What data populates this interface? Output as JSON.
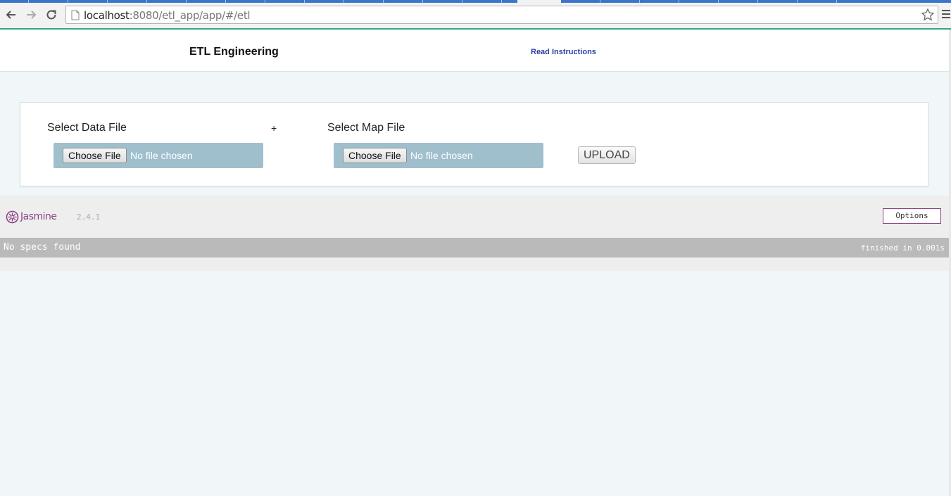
{
  "browser": {
    "url_host": "localhost",
    "url_rest": ":8080/etl_app/app/#/etl"
  },
  "header": {
    "title": "ETL Engineering",
    "read_link": "Read Instructions"
  },
  "upload": {
    "data_label": "Select Data File",
    "plus": "+",
    "map_label": "Select Map File",
    "choose_label": "Choose File",
    "no_file": "No file chosen",
    "upload_label": "UPLOAD"
  },
  "jasmine": {
    "name": "Jasmine",
    "version": "2.4.1",
    "options_label": "Options",
    "status": "No specs found",
    "duration": "finished in 0.001s"
  },
  "colors": {
    "accent_line": "#2fa87e",
    "file_box": "#9fbfcd",
    "jasmine_brand": "#8a4182",
    "link": "#2b3fa3"
  }
}
